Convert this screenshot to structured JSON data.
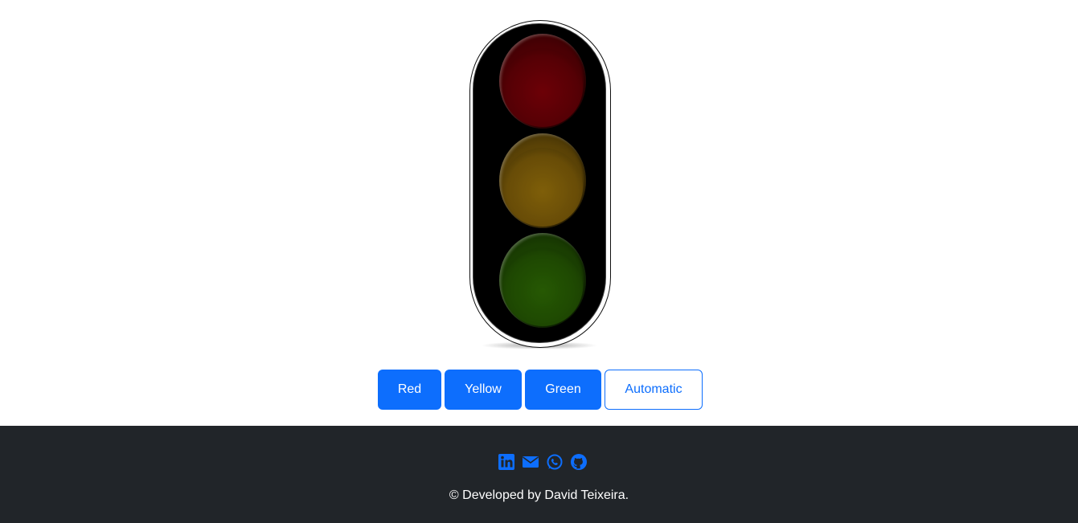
{
  "buttons": {
    "red": "Red",
    "yellow": "Yellow",
    "green": "Green",
    "automatic": "Automatic"
  },
  "traffic_light": {
    "active": "none",
    "lamps": [
      {
        "name": "red",
        "color": "#5e0005"
      },
      {
        "name": "yellow",
        "color": "#6e5208"
      },
      {
        "name": "green",
        "color": "#214d03"
      }
    ]
  },
  "footer": {
    "social_icons": [
      "linkedin-icon",
      "email-icon",
      "whatsapp-icon",
      "github-icon"
    ],
    "credits": "© Developed by David Teixeira."
  },
  "colors": {
    "primary": "#0d6efd",
    "footer_bg": "#212529"
  }
}
